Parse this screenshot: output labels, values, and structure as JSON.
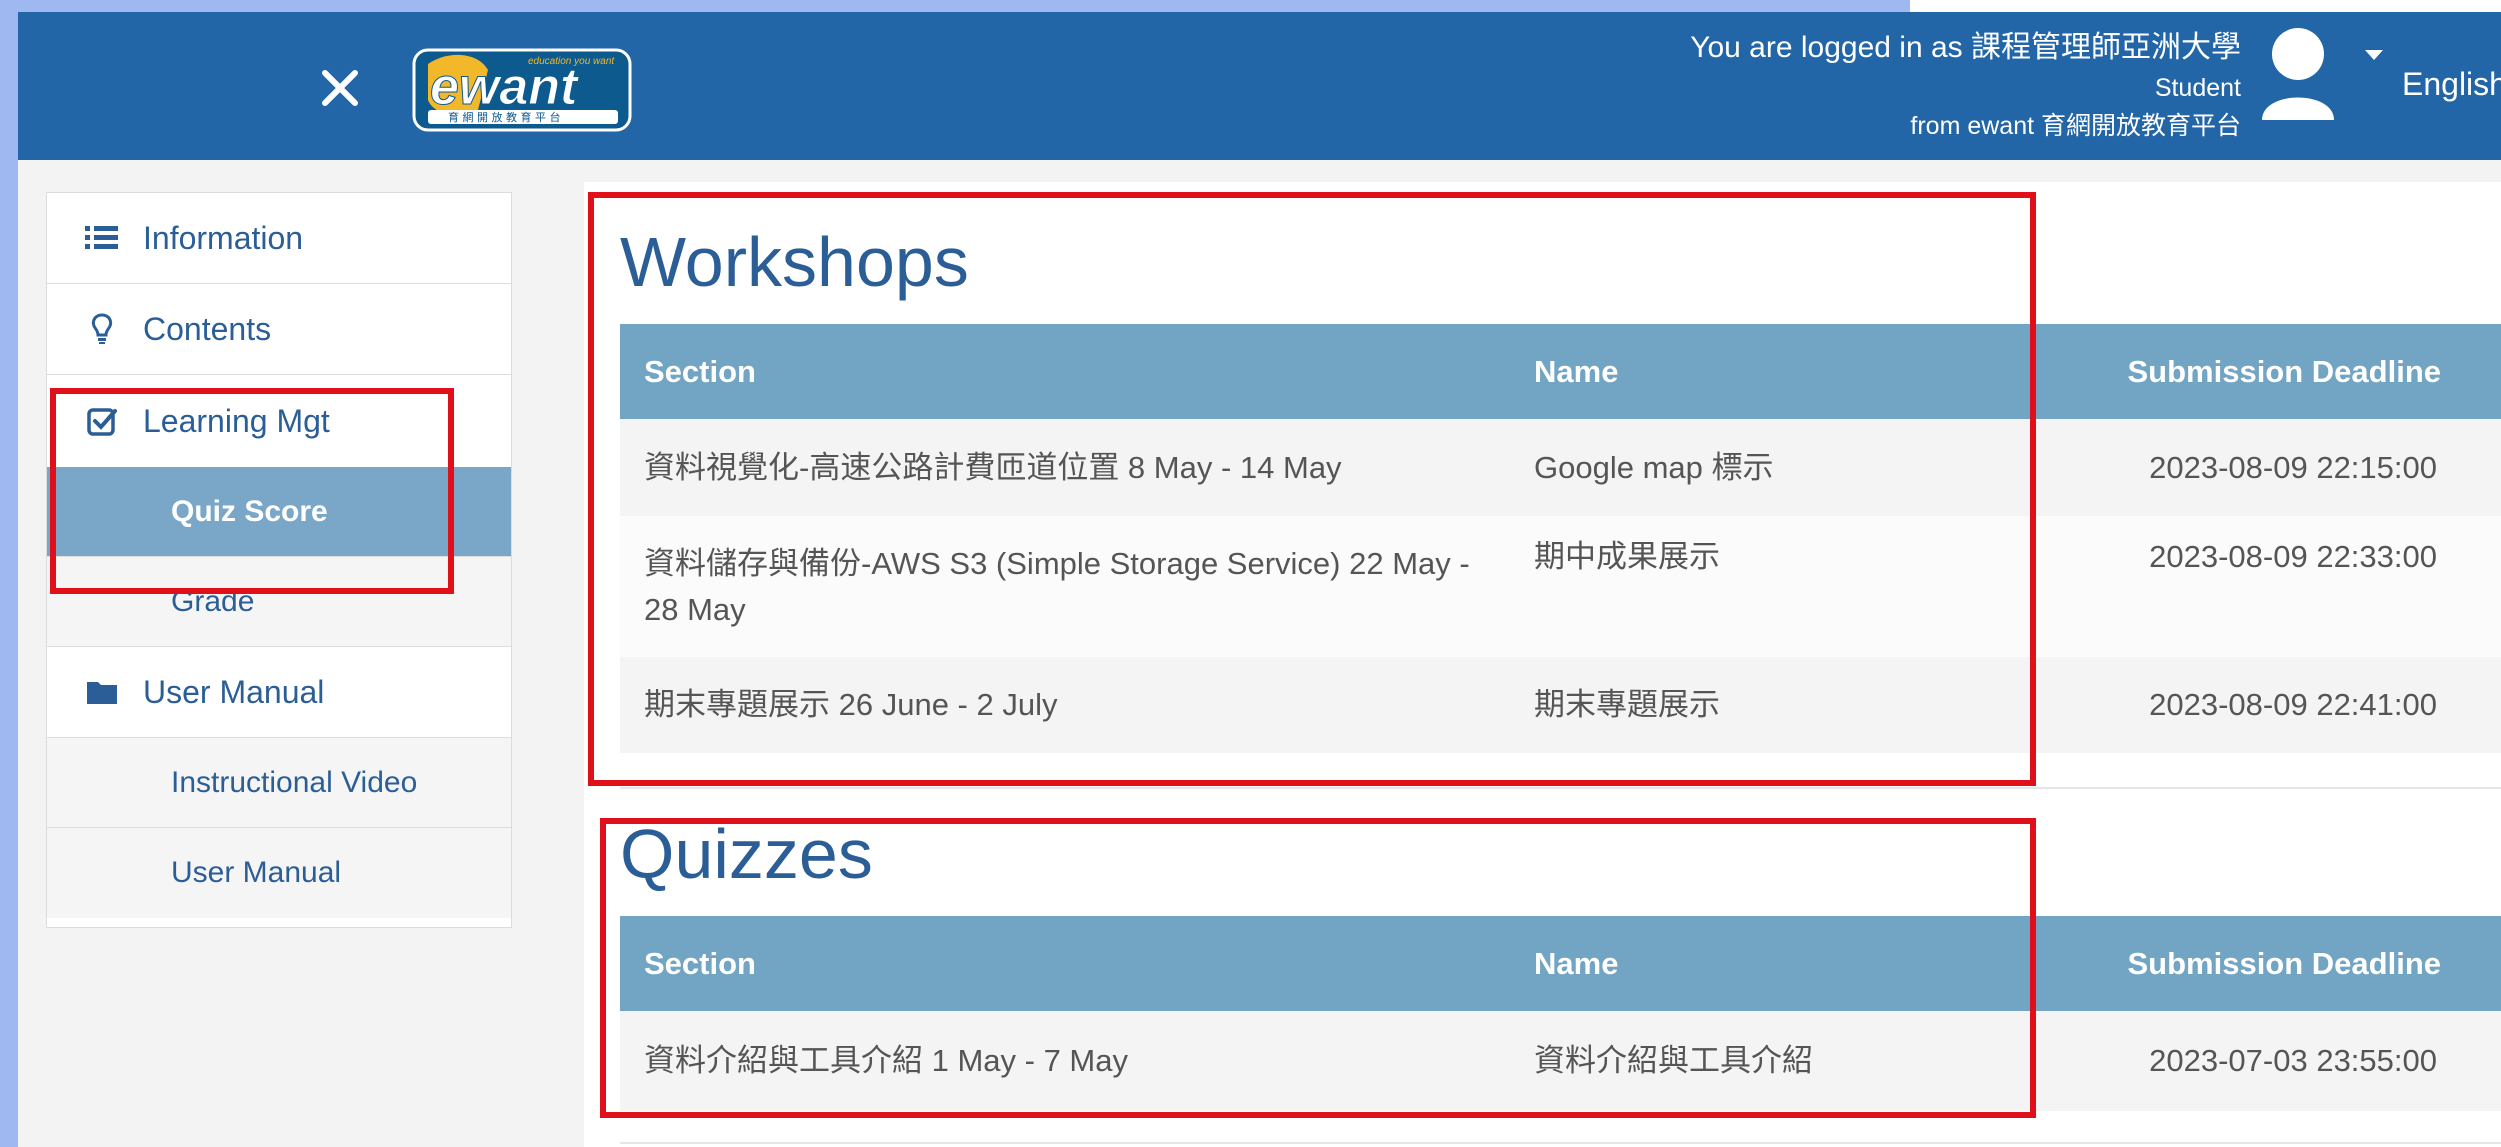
{
  "header": {
    "logo_text": "ewant",
    "logo_tagline": "education you want",
    "logo_subtitle": "育網開放教育平台",
    "login_line": "You are logged in as 課程管理師亞洲大學",
    "role": "Student",
    "from_line": "from ewant 育網開放教育平台",
    "language": "English"
  },
  "sidebar": {
    "items": [
      {
        "label": "Information",
        "icon": "list-icon"
      },
      {
        "label": "Contents",
        "icon": "lightbulb-icon"
      },
      {
        "label": "Learning Mgt",
        "icon": "checkbox-icon"
      },
      {
        "label": "User Manual",
        "icon": "folder-icon"
      }
    ],
    "learning_sub": [
      "Quiz Score",
      "Grade"
    ],
    "manual_sub": [
      "Instructional Video",
      "User Manual"
    ]
  },
  "workshops": {
    "title": "Workshops",
    "columns": [
      "Section",
      "Name",
      "Submission Deadline"
    ],
    "rows": [
      {
        "section": "資料視覺化-高速公路計費匝道位置 8 May - 14 May",
        "name": "Google map 標示",
        "deadline": "2023-08-09 22:15:00"
      },
      {
        "section": "資料儲存與備份-AWS S3 (Simple Storage Service) 22 May - 28 May",
        "name": "期中成果展示",
        "deadline": "2023-08-09 22:33:00"
      },
      {
        "section": "期末專題展示 26 June - 2 July",
        "name": "期末專題展示",
        "deadline": "2023-08-09 22:41:00"
      }
    ]
  },
  "quizzes": {
    "title": "Quizzes",
    "columns": [
      "Section",
      "Name",
      "Submission Deadline"
    ],
    "rows": [
      {
        "section": "資料介紹與工具介紹 1 May - 7 May",
        "name": "資料介紹與工具介紹",
        "deadline": "2023-07-03 23:55:00"
      }
    ]
  },
  "colors": {
    "header_bg": "#2266a8",
    "table_header_bg": "#72a4c3",
    "active_item_bg": "#7aa7c8",
    "link_text": "#2b5e96",
    "annotation": "#e0101a"
  }
}
